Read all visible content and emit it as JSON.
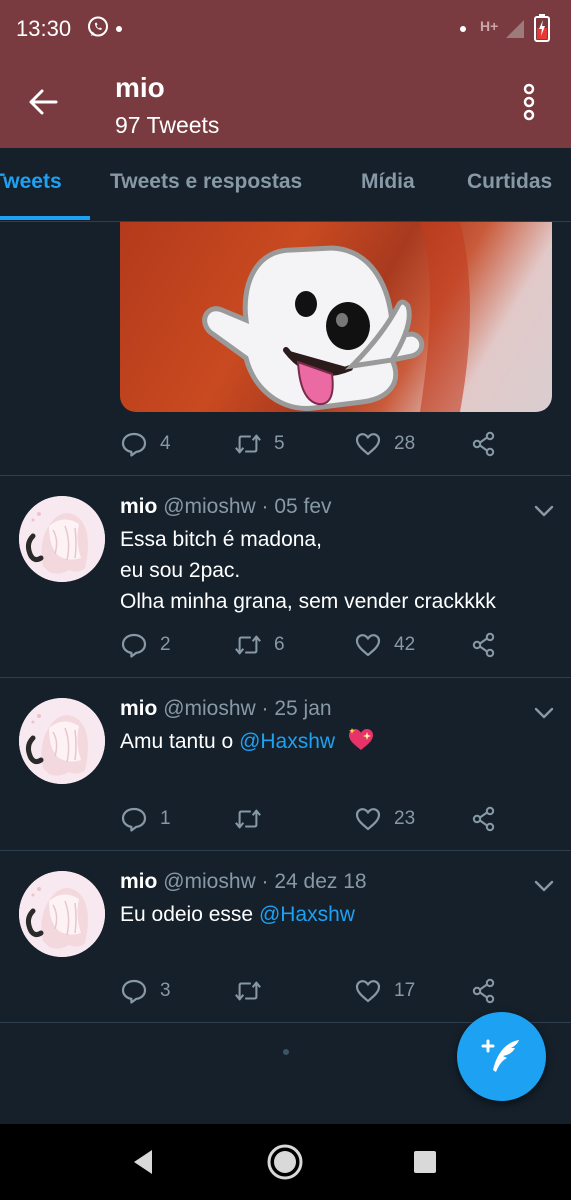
{
  "status_bar": {
    "time": "13:30",
    "network": "H+",
    "icons": [
      "whatsapp-icon",
      "signal-icon",
      "battery-icon"
    ]
  },
  "header": {
    "title": "mio",
    "subtitle": "97 Tweets",
    "icons": [
      "back-arrow-icon",
      "more-vertical-icon"
    ]
  },
  "tabs": [
    {
      "label": "Tweets",
      "active": true
    },
    {
      "label": "Tweets e respostas",
      "active": false
    },
    {
      "label": "Mídia",
      "active": false
    },
    {
      "label": "Curtidas",
      "active": false
    }
  ],
  "media_tweet": {
    "reply_count": "4",
    "retweet_count": "5",
    "like_count": "28"
  },
  "tweets": [
    {
      "name": "mio",
      "meta": "@mioshw · 05 fev",
      "lines": [
        "Essa bitch é madona,",
        "eu sou 2pac.",
        "Olha minha grana, sem vender crackkkk"
      ],
      "reply_count": "2",
      "retweet_count": "6",
      "like_count": "42"
    },
    {
      "name": "mio",
      "meta": "@mioshw · 25 jan",
      "text_before": "Amu tantu o ",
      "mention": "@Haxshw",
      "emoji": "sparkling-heart",
      "reply_count": "1",
      "retweet_count": "",
      "like_count": "23"
    },
    {
      "name": "mio",
      "meta": "@mioshw · 24 dez 18",
      "text_before": "Eu odeio esse ",
      "mention": "@Haxshw",
      "reply_count": "3",
      "retweet_count": "",
      "like_count": "17"
    }
  ],
  "colors": {
    "header_bg": "#7a3b40",
    "page_bg": "#15202b",
    "accent": "#1da1f2",
    "muted": "#8899a6",
    "divider": "#2f3f4e"
  },
  "fab": {
    "icon": "compose-tweet-icon"
  },
  "nav_bar": {
    "icons": [
      "back-triangle-icon",
      "home-circle-icon",
      "recents-square-icon"
    ]
  }
}
